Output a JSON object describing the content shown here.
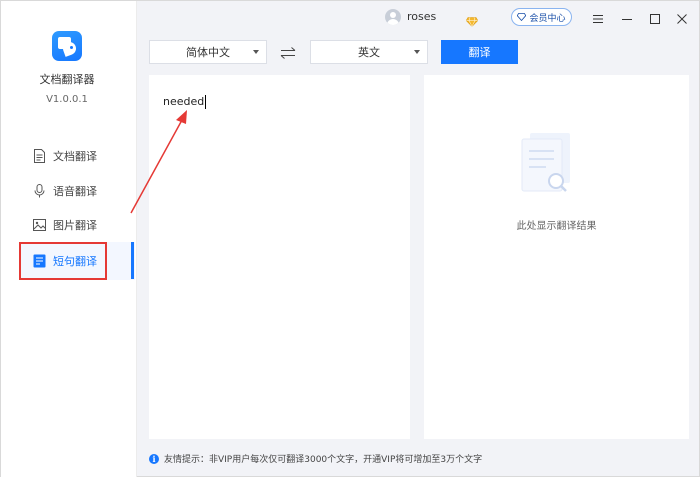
{
  "app": {
    "name": "文档翻译器",
    "version": "V1.0.0.1"
  },
  "sidebar": {
    "items": [
      {
        "label": "文档翻译",
        "icon": "document-icon"
      },
      {
        "label": "语音翻译",
        "icon": "microphone-icon"
      },
      {
        "label": "图片翻译",
        "icon": "image-icon"
      },
      {
        "label": "短句翻译",
        "icon": "short-text-icon",
        "active": true
      }
    ]
  },
  "titlebar": {
    "username": "roses",
    "vip_label": "会员中心"
  },
  "toolbar": {
    "source_language": "简体中文",
    "target_language": "英文",
    "translate_label": "翻译"
  },
  "input": {
    "text": "needed"
  },
  "output": {
    "empty_text": "此处显示翻译结果"
  },
  "footer": {
    "tip": "友情提示：非VIP用户每次仅可翻译3000个文字，开通VIP将可增加至3万个文字"
  },
  "colors": {
    "accent": "#1677ff",
    "annotation": "#e53935",
    "background": "#f2f3f7"
  }
}
